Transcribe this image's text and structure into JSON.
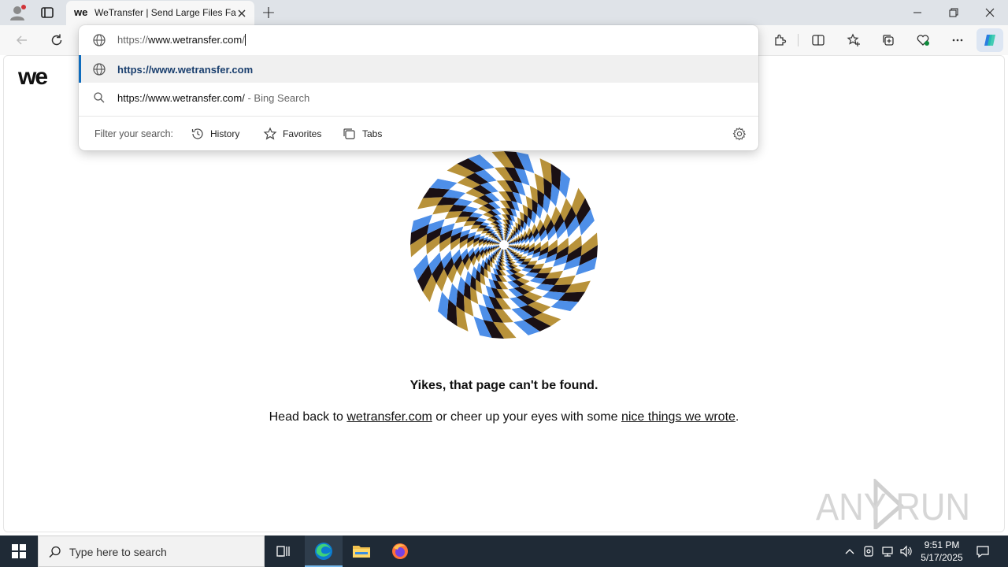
{
  "browser": {
    "tab_title": "WeTransfer | Send Large Files Fast",
    "new_tab_symbol": "+",
    "address": {
      "prefix": "https://",
      "host": "www.wetransfer.com",
      "suffix": "/"
    }
  },
  "omnibox": {
    "suggestions": [
      {
        "text": "https://www.wetransfer.com",
        "icon": "globe-icon"
      },
      {
        "text": "https://www.wetransfer.com/",
        "suffix": " - Bing Search",
        "icon": "search-icon"
      }
    ],
    "filter_label": "Filter your search:",
    "filters": [
      {
        "label": "History",
        "icon": "history-icon"
      },
      {
        "label": "Favorites",
        "icon": "star-icon"
      },
      {
        "label": "Tabs",
        "icon": "tabs-icon"
      }
    ]
  },
  "page": {
    "logo_text": "we",
    "error_title": "Yikes, that page can't be found.",
    "line_before": "Head back to ",
    "link1": "wetransfer.com",
    "line_middle": " or cheer up your eyes with some ",
    "link2": "nice things we wrote",
    "line_after": ".",
    "spiral_colors": [
      "#1a1014",
      "#4e8fe8",
      "#ffffff",
      "#b8923a"
    ]
  },
  "watermark": {
    "text": "ANY RUN"
  },
  "taskbar": {
    "search_placeholder": "Type here to search",
    "time": "9:51 PM",
    "date": "5/17/2025"
  }
}
